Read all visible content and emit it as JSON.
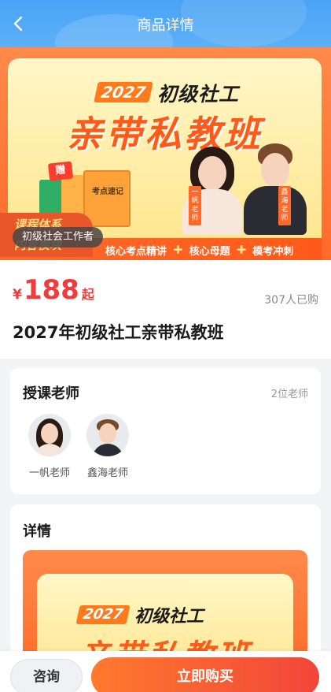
{
  "header": {
    "title": "商品详情",
    "back_icon": "chevron-left-icon"
  },
  "banner": {
    "year": "2027",
    "subtitle": "初级社工",
    "title": "亲带私教班",
    "gift_badge": "赠",
    "book_label": "考点速记",
    "teacher_tags": [
      "一帆老师",
      "鑫海老师"
    ],
    "points": [
      "核心考点精讲",
      "核心母题",
      "模考冲刺"
    ],
    "module_line1": "课程体系",
    "module_line2": "内容模块",
    "category": "初级社会工作者"
  },
  "product": {
    "currency": "¥",
    "price": "188",
    "price_suffix": "起",
    "sold": "307人已购",
    "title": "2027年初级社工亲带私教班"
  },
  "teachers": {
    "title": "授课老师",
    "count": "2位老师",
    "list": [
      {
        "name": "一帆老师"
      },
      {
        "name": "鑫海老师"
      }
    ]
  },
  "detail": {
    "title": "详情",
    "banner_year": "2027",
    "banner_subtitle": "初级社工",
    "banner_title": "亲带私教班"
  },
  "bottom": {
    "consult": "咨询",
    "buy": "立即购买"
  },
  "colors": {
    "header": "#4aa3f5",
    "accent": "#ff6a2a",
    "price": "#f03c3c"
  }
}
